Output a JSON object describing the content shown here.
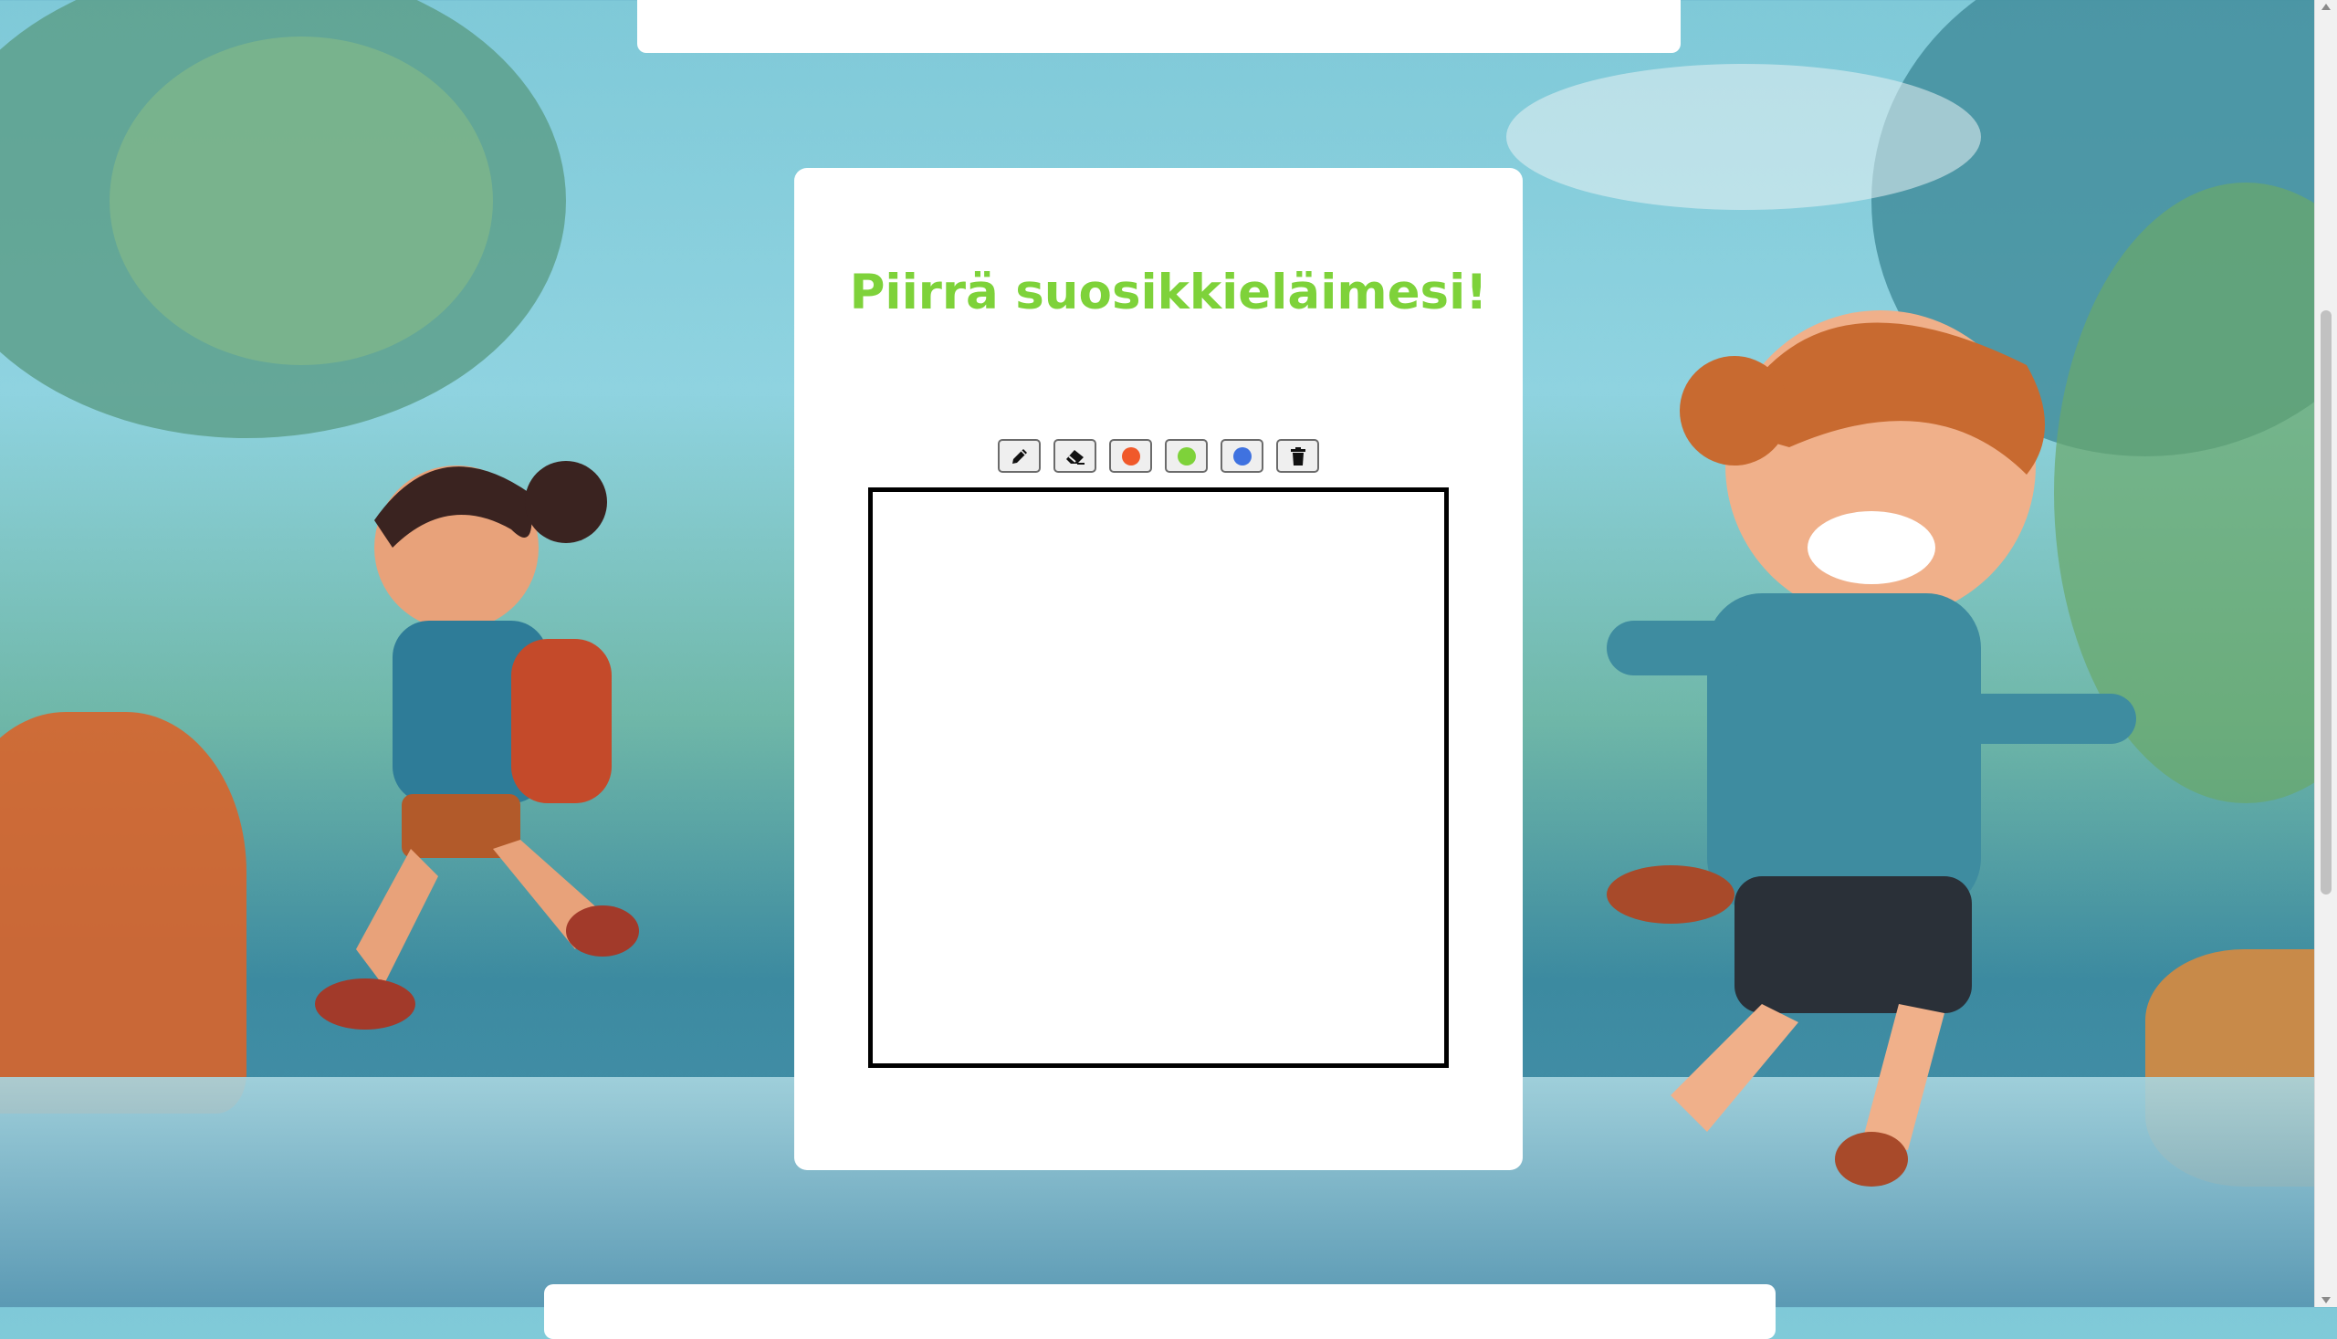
{
  "page": {
    "heading": "Piirrä suosikkieläimesi!",
    "heading_color": "#7ed23a"
  },
  "toolbar": {
    "tools": [
      {
        "name": "pencil",
        "icon": "pencil-icon"
      },
      {
        "name": "eraser",
        "icon": "eraser-icon"
      },
      {
        "name": "color-orange",
        "icon": "dot",
        "color": "#f0592a"
      },
      {
        "name": "color-green",
        "icon": "dot",
        "color": "#7ed23a"
      },
      {
        "name": "color-blue",
        "icon": "dot",
        "color": "#3f72e0"
      },
      {
        "name": "clear",
        "icon": "trash-icon"
      }
    ]
  },
  "colors": {
    "card": "#ffffff",
    "canvas_border": "#000000"
  }
}
